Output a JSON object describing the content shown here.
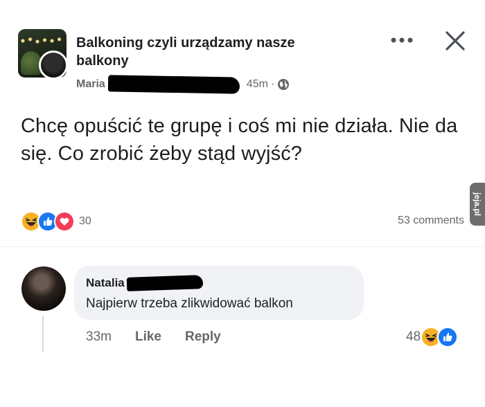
{
  "post": {
    "group_name": "Balkoning czyli urządzamy nasze balkony",
    "author": "Maria",
    "time_ago": "45m",
    "separator": "·",
    "body": "Chcę opuścić te grupę i coś mi nie działa.  Nie da się.  Co zrobić żeby stąd wyjść?",
    "reaction_count": "30",
    "comments_count": "53 comments",
    "reactions": [
      "haha-icon",
      "like-icon",
      "love-icon"
    ]
  },
  "watermark": {
    "text": "jeja.pl"
  },
  "comment": {
    "author": "Natalia",
    "text": "Najpierw trzeba zlikwidować balkon",
    "time": "33m",
    "like_label": "Like",
    "reply_label": "Reply",
    "reaction_count": "48",
    "reactions": [
      "haha-icon",
      "like-icon"
    ]
  },
  "colors": {
    "text": "#1c1e21",
    "secondary": "#65676b",
    "bubble": "#f0f2f5",
    "like_blue": "#1877f2",
    "love_red": "#f33e58",
    "haha_yellow": "#f7b125"
  }
}
